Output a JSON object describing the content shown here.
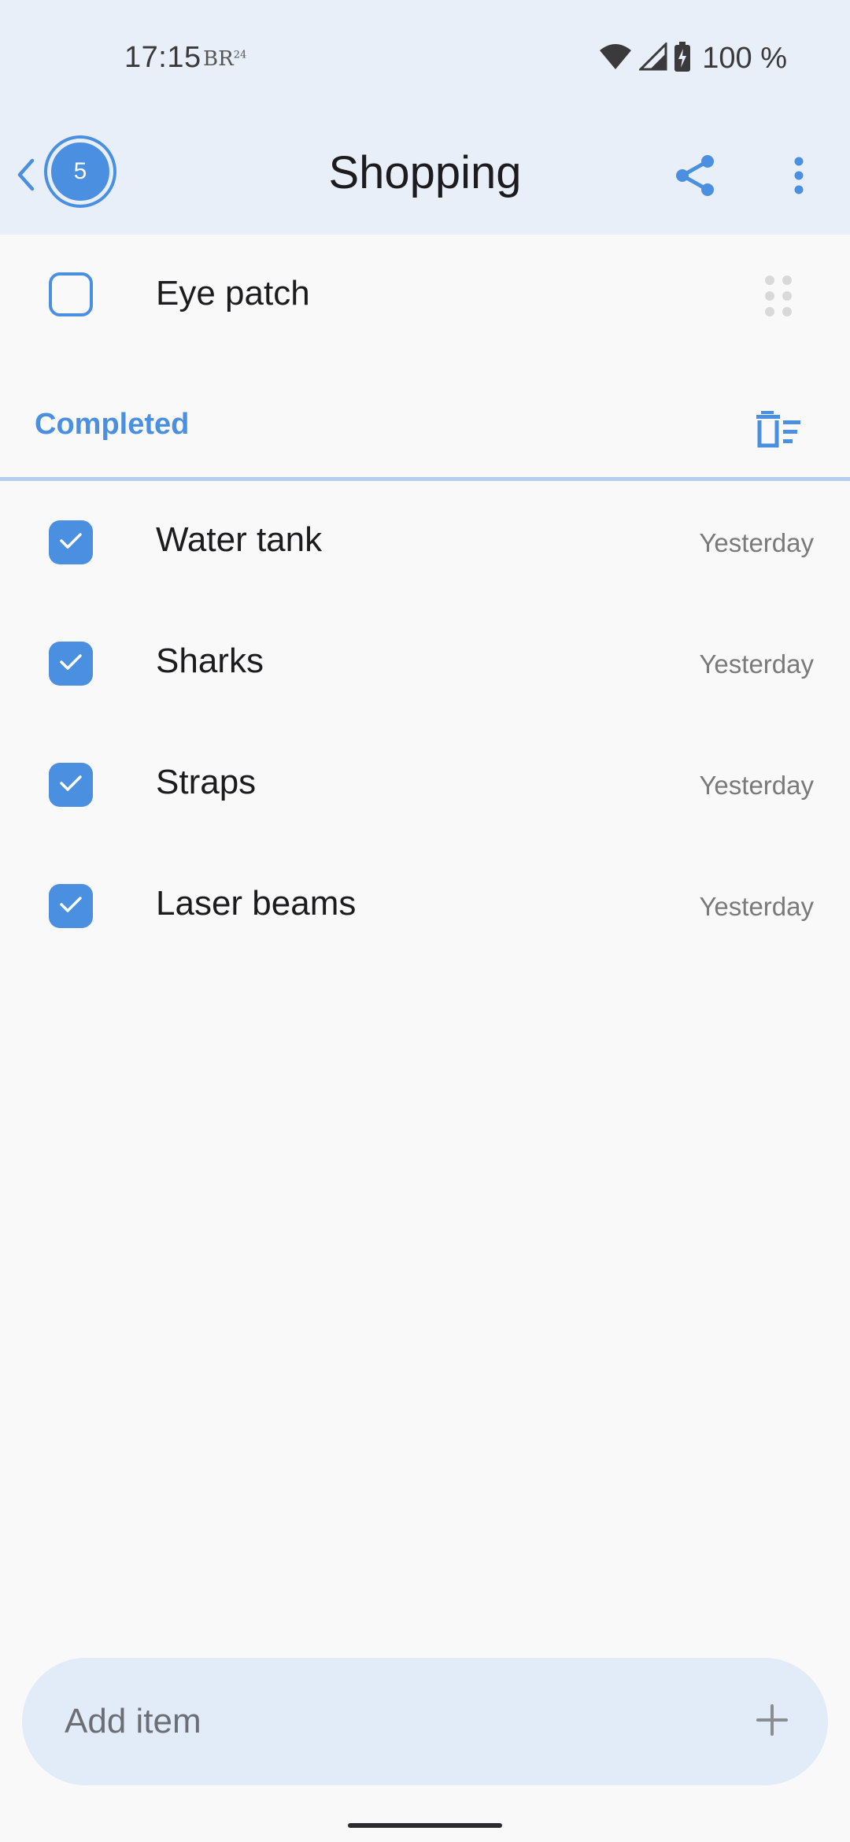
{
  "status_bar": {
    "time": "17:15",
    "channel_logo_text": "BR",
    "channel_logo_sup": "24",
    "battery": "100 %"
  },
  "header": {
    "title": "Shopping",
    "badge_count": "5",
    "back_icon": "chevron-left-icon",
    "share_icon": "share-icon",
    "more_icon": "more-vertical-icon"
  },
  "pending": [
    {
      "label": "Eye patch"
    }
  ],
  "completed": {
    "title": "Completed",
    "items": [
      {
        "label": "Water tank",
        "date": "Yesterday"
      },
      {
        "label": "Sharks",
        "date": "Yesterday"
      },
      {
        "label": "Straps",
        "date": "Yesterday"
      },
      {
        "label": "Laser beams",
        "date": "Yesterday"
      }
    ]
  },
  "add_bar": {
    "placeholder": "Add item"
  },
  "colors": {
    "accent": "#4a8fe0",
    "header_bg": "#e8eff9",
    "add_bar_bg": "#e2ebf8"
  }
}
